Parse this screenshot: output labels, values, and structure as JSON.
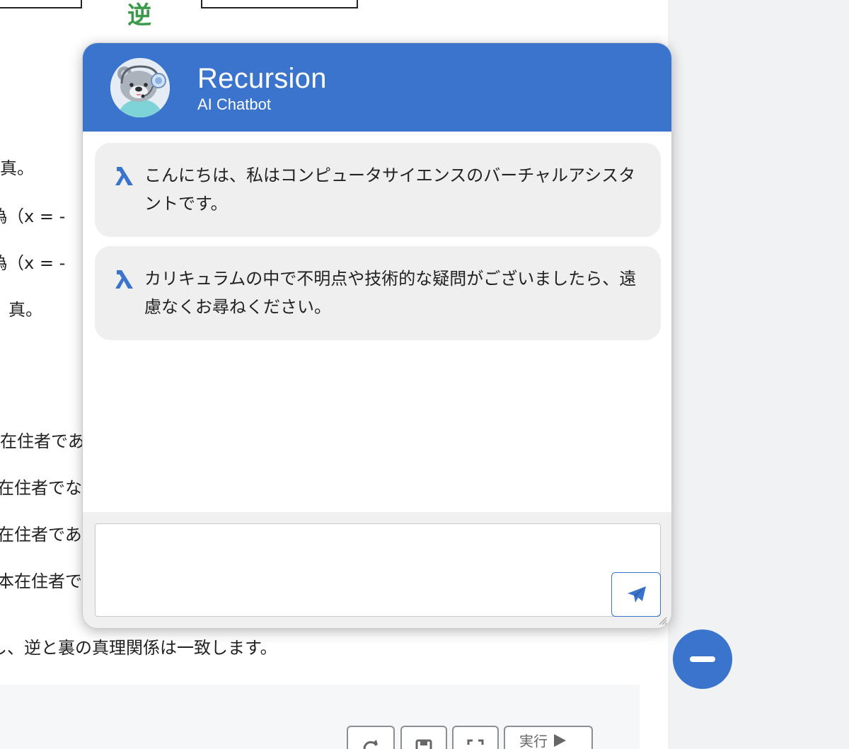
{
  "background_page": {
    "green_char": "逆",
    "lines": [
      "真。",
      "偽（x = -",
      "偽（x = -",
      "、真。",
      "在住者であ",
      "在住者でな",
      "在住者であ",
      "本在住者で",
      "し、逆と裏の真理関係は一致します。"
    ],
    "run_label": "実行"
  },
  "chatbot": {
    "title": "Recursion",
    "subtitle": "AI Chatbot",
    "avatar_icon": "bear-with-headset-avatar",
    "messages": [
      {
        "icon": "lambda-icon",
        "text": "こんにちは、私はコンピュータサイエンスのバーチャルアシスタントです。"
      },
      {
        "icon": "lambda-icon",
        "text": "カリキュラムの中で不明点や技術的な疑問がございましたら、遠慮なくお尋ねください。"
      }
    ],
    "input": {
      "value": "",
      "placeholder": ""
    },
    "send_icon": "paper-plane-icon",
    "minimize_icon": "minus-icon"
  },
  "colors": {
    "accent": "#3a74cc",
    "bubble": "#efefef",
    "green": "#3a9a4a"
  }
}
